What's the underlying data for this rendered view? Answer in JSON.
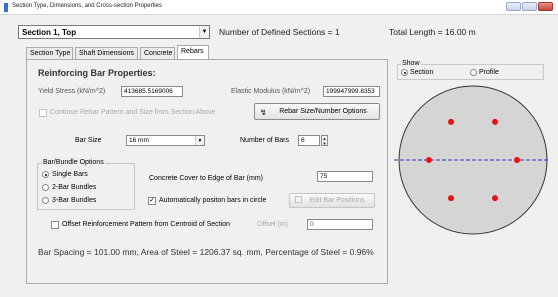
{
  "window": {
    "title": "Section Type, Dimensions, and Cross-section Properties"
  },
  "header": {
    "section_select": "Section 1, Top",
    "defined_sections": "Number of Defined Sections = 1",
    "total_length": "Total Length = 16.00 m"
  },
  "tabs": [
    "Section Type",
    "Shaft Dimensions",
    "Concrete",
    "Rebars"
  ],
  "rebars": {
    "heading": "Reinforcing Bar Properties:",
    "yield_label": "Yield Stress (kN/m^2)",
    "yield_value": "413685.5169006",
    "elastic_label": "Elastic Modulus (kN/m^2)",
    "elastic_value": "199947999.8353",
    "continue_label": "Continue Rebar Pattern and Size from Section Above",
    "rebar_size_button": "Rebar Size/Number Options",
    "bar_size_label": "Bar Size",
    "bar_size_value": "16 mm",
    "num_bars_label": "Number of Bars",
    "num_bars_value": "6",
    "bundle_group_title": "Bar/Bundle Options",
    "bundle_options": [
      "Single Bars",
      "2-Bar Bundles",
      "3-Bar Bundles"
    ],
    "cover_label": "Concrete Cover to Edge of Bar (mm)",
    "cover_value": "75",
    "auto_position_label": "Automatically positon bars in circle",
    "edit_positions_button": "Edit Bar Positions",
    "offset_label": "Offset Reinforcement Pattern from Centroid of Section",
    "offset_m_label": "Offset (m)",
    "offset_value": "0",
    "summary": "Bar Spacing = 101.00 mm, Area of Steel = 1206.37 sq. mm, Percentage of Steel = 0.96%"
  },
  "show": {
    "title": "Show",
    "options": [
      "Section",
      "Profile"
    ]
  },
  "colors": {
    "bar": "#e81010",
    "axis": "#2f2fd0",
    "section": "#d5d5d5"
  }
}
